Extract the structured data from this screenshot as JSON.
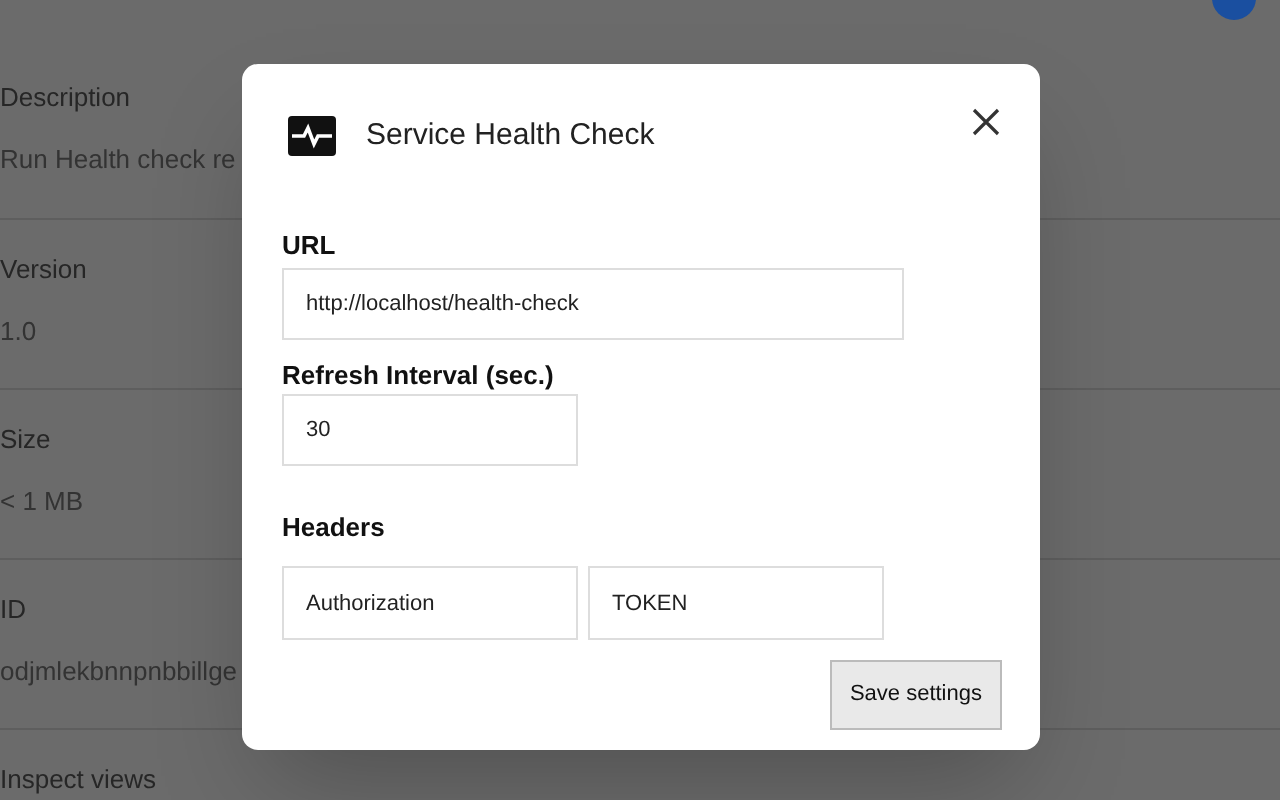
{
  "details": [
    {
      "label": "Description",
      "value": "Run Health check re"
    },
    {
      "label": "Version",
      "value": "1.0"
    },
    {
      "label": "Size",
      "value": "< 1 MB"
    },
    {
      "label": "ID",
      "value": "odjmlekbnnpnbbillge"
    },
    {
      "label": "Inspect views"
    }
  ],
  "dialog": {
    "title": "Service Health Check",
    "url": {
      "label": "URL",
      "value": "http://localhost/health-check"
    },
    "interval": {
      "label": "Refresh Interval (sec.)",
      "value": "30"
    },
    "headers": {
      "label": "Headers",
      "rows": [
        {
          "name": "Authorization",
          "value": "TOKEN"
        }
      ]
    },
    "save_button": "Save settings"
  }
}
